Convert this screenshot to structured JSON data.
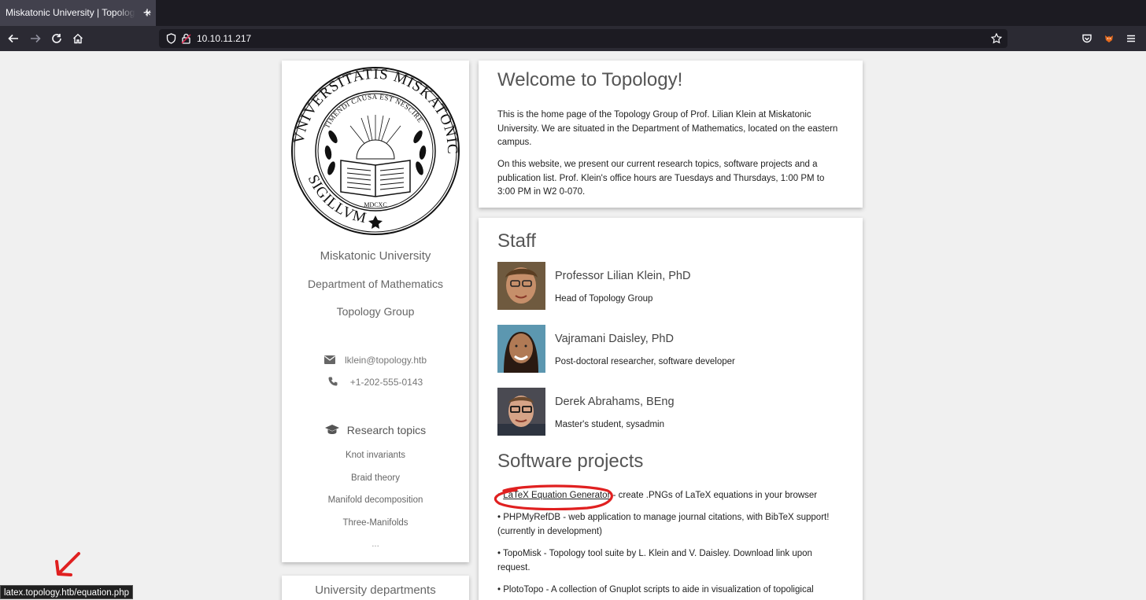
{
  "browser": {
    "tab_title": "Miskatonic University | Topology Group",
    "tab_close": "×",
    "new_tab": "+",
    "url": "10.10.11.217",
    "status_url": "latex.topology.htb/equation.php"
  },
  "sidebar": {
    "seal": {
      "ring_text": "UNIVERSITATIS MISKATONICIENSIS SIGILLUM",
      "motto": "TIMENDI CAUSA EST NESCIRE",
      "year": "MDCXC"
    },
    "university": "Miskatonic University",
    "department": "Department of Mathematics",
    "group": "Topology Group",
    "email": "lklein@topology.htb",
    "phone": "+1-202-555-0143",
    "research_heading": "Research topics",
    "topics": [
      "Knot invariants",
      "Braid theory",
      "Manifold decomposition",
      "Three-Manifolds",
      "..."
    ],
    "departments_heading": "University departments"
  },
  "welcome": {
    "title": "Welcome to Topology!",
    "p1": "This is the home page of the Topology Group of Prof. Lilian Klein at Miskatonic University. We are situated in the Department of Mathematics, located on the eastern campus.",
    "p2": "On this website, we present our current research topics, software projects and a publication list. Prof. Klein's office hours are Tuesdays and Thursdays, 1:00 PM to 3:00 PM in W2 0-070."
  },
  "staff": {
    "title": "Staff",
    "members": [
      {
        "name": "Professor Lilian Klein, PhD",
        "role": "Head of Topology Group"
      },
      {
        "name": "Vajramani Daisley, PhD",
        "role": "Post-doctoral researcher, software developer"
      },
      {
        "name": "Derek Abrahams, BEng",
        "role": "Master's student, sysadmin"
      }
    ]
  },
  "software": {
    "title": "Software projects",
    "p1_link": "LaTeX Equation Generator",
    "p1_rest": " - create .PNGs of LaTeX equations in your browser",
    "p2": "• PHPMyRefDB - web application to manage journal citations, with BibTeX support! (currently in development)",
    "p3": "• TopoMisk - Topology tool suite by L. Klein and V. Daisley. Download link upon request.",
    "p4": "• PlotoTopo - A collection of Gnuplot scripts to aide in visualization of topoligical"
  },
  "colors": {
    "annotation": "#e02020",
    "chrome_dark": "#1c1b22",
    "chrome_nav": "#2b2a33"
  }
}
